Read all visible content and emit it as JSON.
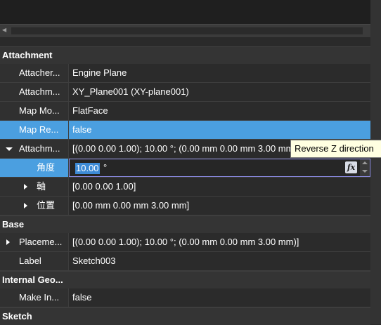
{
  "sections": {
    "attachment": "Attachment",
    "base": "Base",
    "internal_geometry": "Internal Geo...",
    "sketch": "Sketch"
  },
  "attachment": {
    "attacher": {
      "name": "Attacher...",
      "value": "Engine Plane"
    },
    "attachment_support": {
      "name": "Attachm...",
      "value": "XY_Plane001 (XY-plane001)"
    },
    "map_mode": {
      "name": "Map Mo...",
      "value": "FlatFace"
    },
    "map_reversed": {
      "name": "Map Re...",
      "value": "false"
    },
    "attachment_offset": {
      "name": "Attachm...",
      "value": "[(0.00 0.00 1.00); 10.00 °; (0.00 mm  0.00 mm  3.00 mm)]"
    },
    "angle": {
      "name": "角度",
      "value": "10.00",
      "unit": "°"
    },
    "axis": {
      "name": "軸",
      "value": "[0.00 0.00 1.00]"
    },
    "position": {
      "name": "位置",
      "value": "[0.00 mm 0.00 mm 3.00 mm]"
    }
  },
  "base": {
    "placement": {
      "name": "Placeme...",
      "value": "[(0.00 0.00 1.00); 10.00 °; (0.00 mm  0.00 mm  3.00 mm)]"
    },
    "label": {
      "name": "Label",
      "value": "Sketch003"
    }
  },
  "internal": {
    "make_internals": {
      "name": "Make In...",
      "value": "false"
    }
  },
  "tooltip": "Reverse Z direction",
  "formula_button": "fx",
  "colors": {
    "selection": "#4b9fe0",
    "background": "#2b2b2b",
    "tooltip_bg": "#ffffe1"
  }
}
